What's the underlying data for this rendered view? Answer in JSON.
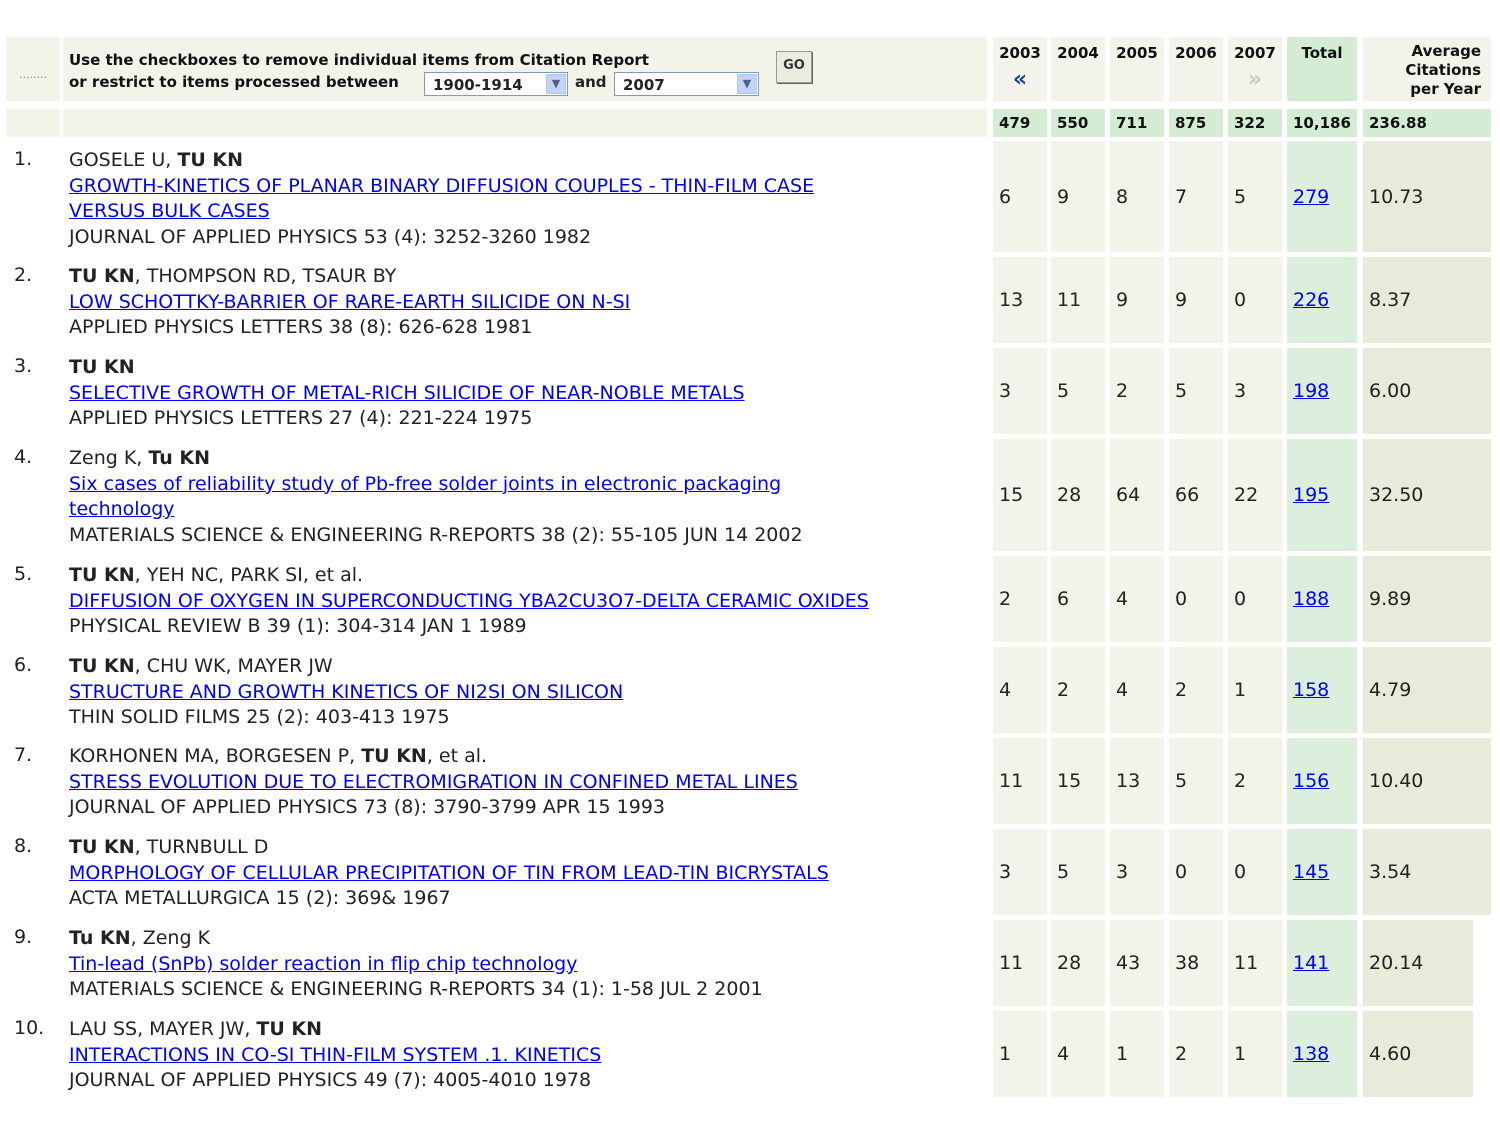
{
  "header": {
    "dots": "........",
    "instruction_line1": "Use the checkboxes to remove individual items from Citation Report",
    "instruction_line2": "or restrict to items processed between",
    "from_select_value": "1900-1914",
    "and_label": "and",
    "to_select_value": "2007",
    "go_button": "GO",
    "years": [
      "2003",
      "2004",
      "2005",
      "2006",
      "2007"
    ],
    "total_label": "Total",
    "avg_label_1": "Average",
    "avg_label_2": "Citations",
    "avg_label_3": "per Year",
    "prev_icon": "double-left-arrow-icon",
    "next_icon": "double-right-arrow-icon"
  },
  "totals": {
    "y2003": "479",
    "y2004": "550",
    "y2005": "711",
    "y2006": "875",
    "y2007": "322",
    "total": "10,186",
    "avg": "236.88"
  },
  "rows": [
    {
      "num": "1.",
      "authors_pre": "GOSELE U, ",
      "authors_bold": "TU KN",
      "authors_post": "",
      "title_l1": "GROWTH-KINETICS OF PLANAR BINARY DIFFUSION COUPLES - THIN-FILM CASE",
      "title_l2": "VERSUS BULK CASES",
      "source": "JOURNAL OF APPLIED PHYSICS 53 (4): 3252-3260 1982",
      "c": [
        "6",
        "9",
        "8",
        "7",
        "5"
      ],
      "total": "279",
      "avg": "10.73"
    },
    {
      "num": "2.",
      "authors_pre": "",
      "authors_bold": "TU KN",
      "authors_post": ", THOMPSON RD, TSAUR BY",
      "title_l1": "LOW SCHOTTKY-BARRIER OF RARE-EARTH SILICIDE ON N-SI",
      "title_l2": "",
      "source": "APPLIED PHYSICS LETTERS 38 (8): 626-628 1981",
      "c": [
        "13",
        "11",
        "9",
        "9",
        "0"
      ],
      "total": "226",
      "avg": "8.37"
    },
    {
      "num": "3.",
      "authors_pre": "",
      "authors_bold": "TU KN",
      "authors_post": "",
      "title_l1": "SELECTIVE GROWTH OF METAL-RICH SILICIDE OF NEAR-NOBLE METALS",
      "title_l2": "",
      "source": "APPLIED PHYSICS LETTERS 27 (4): 221-224 1975",
      "c": [
        "3",
        "5",
        "2",
        "5",
        "3"
      ],
      "total": "198",
      "avg": "6.00"
    },
    {
      "num": "4.",
      "authors_pre": "Zeng K, ",
      "authors_bold": "Tu KN",
      "authors_post": "",
      "title_l1": "Six cases of reliability study of Pb-free solder joints in electronic packaging",
      "title_l2": "technology",
      "source": "MATERIALS SCIENCE & ENGINEERING R-REPORTS 38 (2): 55-105 JUN 14 2002",
      "c": [
        "15",
        "28",
        "64",
        "66",
        "22"
      ],
      "total": "195",
      "avg": "32.50"
    },
    {
      "num": "5.",
      "authors_pre": "",
      "authors_bold": "TU KN",
      "authors_post": ", YEH NC, PARK SI, et al.",
      "title_l1": "DIFFUSION OF OXYGEN IN SUPERCONDUCTING YBA2CU3O7-DELTA CERAMIC OXIDES",
      "title_l2": "",
      "source": "PHYSICAL REVIEW B 39 (1): 304-314 JAN 1 1989",
      "c": [
        "2",
        "6",
        "4",
        "0",
        "0"
      ],
      "total": "188",
      "avg": "9.89"
    },
    {
      "num": "6.",
      "authors_pre": "",
      "authors_bold": "TU KN",
      "authors_post": ", CHU WK, MAYER JW",
      "title_l1": "STRUCTURE AND GROWTH KINETICS OF NI2SI ON SILICON",
      "title_l2": "",
      "source": "THIN SOLID FILMS 25 (2): 403-413 1975",
      "c": [
        "4",
        "2",
        "4",
        "2",
        "1"
      ],
      "total": "158",
      "avg": "4.79"
    },
    {
      "num": "7.",
      "authors_pre": "KORHONEN MA, BORGESEN P, ",
      "authors_bold": "TU KN",
      "authors_post": ", et al.",
      "title_l1": "STRESS EVOLUTION DUE TO ELECTROMIGRATION IN CONFINED METAL LINES",
      "title_l2": "",
      "source": "JOURNAL OF APPLIED PHYSICS 73 (8): 3790-3799 APR 15 1993",
      "c": [
        "11",
        "15",
        "13",
        "5",
        "2"
      ],
      "total": "156",
      "avg": "10.40"
    },
    {
      "num": "8.",
      "authors_pre": "",
      "authors_bold": "TU KN",
      "authors_post": ", TURNBULL D",
      "title_l1": "MORPHOLOGY OF CELLULAR PRECIPITATION OF TIN FROM LEAD-TIN BICRYSTALS",
      "title_l2": "",
      "source": "ACTA METALLURGICA 15 (2): 369& 1967",
      "c": [
        "3",
        "5",
        "3",
        "0",
        "0"
      ],
      "total": "145",
      "avg": "3.54"
    },
    {
      "num": "9.",
      "authors_pre": "",
      "authors_bold": "Tu KN",
      "authors_post": ", Zeng K",
      "title_l1": "Tin-lead (SnPb) solder reaction in flip chip technology",
      "title_l2": "",
      "source": "MATERIALS SCIENCE & ENGINEERING R-REPORTS 34 (1): 1-58 JUL 2 2001",
      "c": [
        "11",
        "28",
        "43",
        "38",
        "11"
      ],
      "total": "141",
      "avg": "20.14"
    },
    {
      "num": "10.",
      "authors_pre": "LAU SS, MAYER JW, ",
      "authors_bold": "TU KN",
      "authors_post": "",
      "title_l1": "INTERACTIONS IN CO-SI THIN-FILM SYSTEM .1. KINETICS",
      "title_l2": "",
      "source": "JOURNAL OF APPLIED PHYSICS 49 (7): 4005-4010 1978",
      "c": [
        "1",
        "4",
        "1",
        "2",
        "1"
      ],
      "total": "138",
      "avg": "4.60"
    }
  ]
}
